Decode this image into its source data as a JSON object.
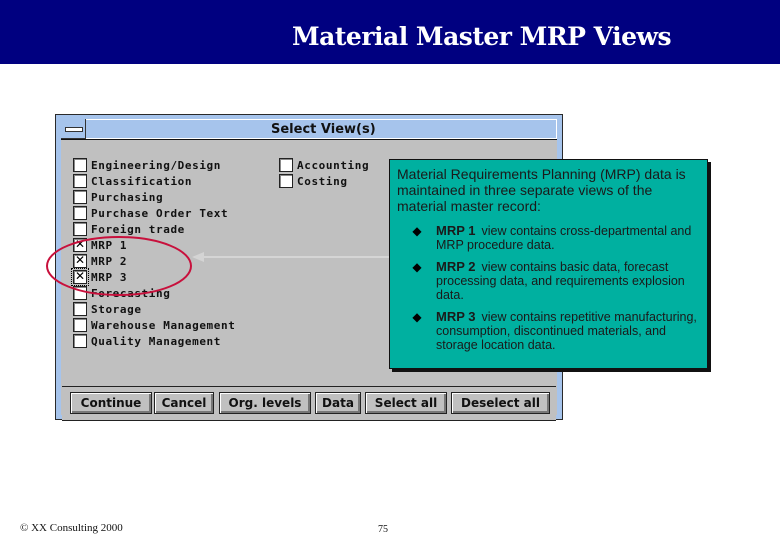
{
  "slide": {
    "title": "Material Master MRP Views",
    "footer_copyright": "© XX Consulting 2000",
    "page_number": "75"
  },
  "dialog": {
    "title": "Select View(s)",
    "system_menu_icon": "system-menu-icon",
    "left_column": [
      {
        "label": "Engineering/Design",
        "checked": false
      },
      {
        "label": "Classification",
        "checked": false
      },
      {
        "label": "Purchasing",
        "checked": false
      },
      {
        "label": "Purchase Order Text",
        "checked": false
      },
      {
        "label": "Foreign trade",
        "checked": false
      },
      {
        "label": "MRP 1",
        "checked": true
      },
      {
        "label": "MRP 2",
        "checked": true
      },
      {
        "label": "MRP 3",
        "checked": true
      },
      {
        "label": "Forecasting",
        "checked": false
      },
      {
        "label": "Storage",
        "checked": false
      },
      {
        "label": "Warehouse Management",
        "checked": false
      },
      {
        "label": "Quality Management",
        "checked": false
      }
    ],
    "right_column": [
      {
        "label": "Accounting",
        "checked": false
      },
      {
        "label": "Costing",
        "checked": false
      }
    ],
    "buttons": {
      "continue": "Continue",
      "cancel": "Cancel",
      "org_levels": "Org. levels",
      "data": "Data",
      "select_all": "Select all",
      "deselect_all": "Deselect all"
    }
  },
  "callout": {
    "intro": "Material Requirements Planning (MRP) data is maintained in three separate views of the material master record:",
    "bullet_icon": "◆",
    "bullets": [
      {
        "term": "MRP 1",
        "text": "view contains cross-departmental and MRP procedure data."
      },
      {
        "term": "MRP 2",
        "text": "view contains basic data, forecast processing data, and requirements explosion data."
      },
      {
        "term": "MRP 3",
        "text": "view contains repetitive manufacturing, consumption, discontinued materials, and storage location data."
      }
    ]
  },
  "colors": {
    "header_bg": "#000080",
    "dialog_frame": "#a6c4ec",
    "dialog_client": "#c0c0c0",
    "callout_bg": "#00b0a0",
    "highlight_ellipse": "#c8103c"
  }
}
